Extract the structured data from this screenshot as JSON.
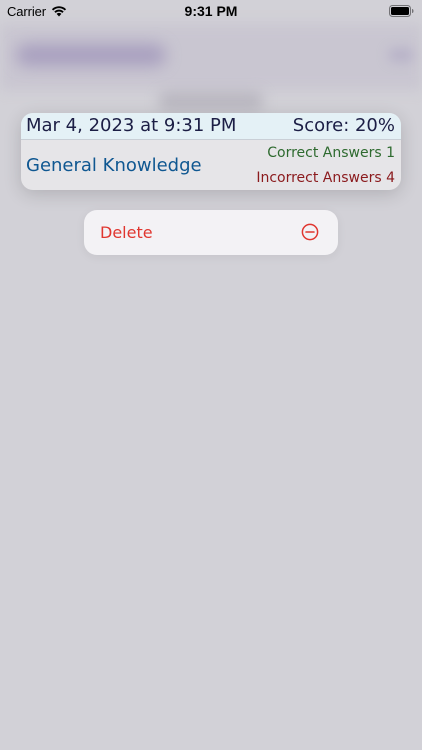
{
  "status_bar": {
    "carrier": "Carrier",
    "time": "9:31 PM",
    "wifi_icon": "wifi-icon",
    "battery_icon": "battery-full-icon"
  },
  "result_card": {
    "date": "Mar 4, 2023 at 9:31 PM",
    "score": "Score: 20%",
    "category": "General Knowledge",
    "correct": "Correct Answers 1",
    "incorrect": "Incorrect Answers 4"
  },
  "context_menu": {
    "items": [
      {
        "label": "Delete",
        "icon": "minus-circle-icon"
      }
    ]
  },
  "colors": {
    "header_background": "#e4f1f6",
    "title_text": "#1c1e45",
    "category_text": "#0f5791",
    "correct_text": "#2e6a2f",
    "incorrect_text": "#8b1a1d",
    "destructive": "#e0362f",
    "background_dim": "#cfcdd4"
  }
}
